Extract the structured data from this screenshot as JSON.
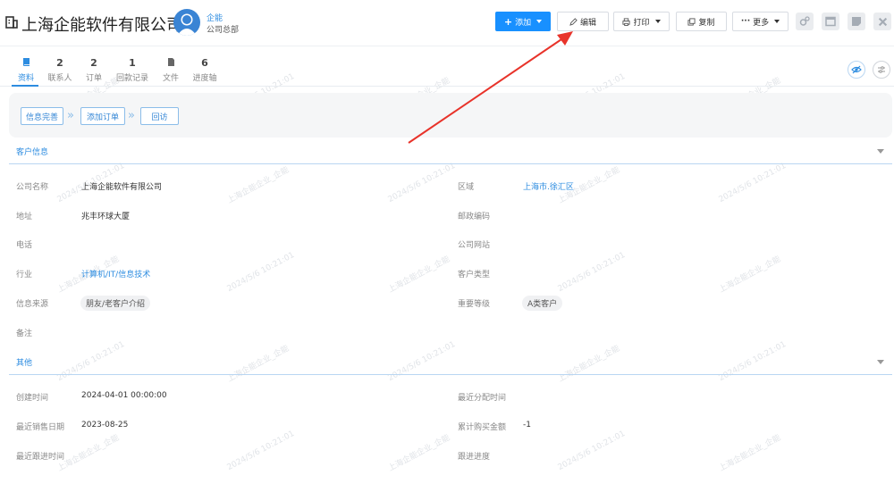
{
  "header": {
    "title": "上海企能软件有限公司",
    "owner_name": "企能",
    "owner_sub": "公司总部",
    "buttons": {
      "add": "添加",
      "edit": "编辑",
      "print": "打印",
      "copy": "复制",
      "more": "更多"
    }
  },
  "tabs": [
    {
      "count": "",
      "label": "资料"
    },
    {
      "count": "2",
      "label": "联系人"
    },
    {
      "count": "2",
      "label": "订单"
    },
    {
      "count": "1",
      "label": "回款记录"
    },
    {
      "count": "",
      "label": "文件"
    },
    {
      "count": "6",
      "label": "进度轴"
    }
  ],
  "progress": [
    "信息完善",
    "添加订单",
    "回访"
  ],
  "sections": {
    "customer": "客户信息",
    "other": "其他"
  },
  "fields": {
    "company_name": {
      "label": "公司名称",
      "value": "上海企能软件有限公司"
    },
    "region": {
      "label": "区域",
      "value": "上海市.徐汇区"
    },
    "address": {
      "label": "地址",
      "value": "兆丰环球大厦"
    },
    "postcode": {
      "label": "邮政编码",
      "value": ""
    },
    "phone": {
      "label": "电话",
      "value": ""
    },
    "website": {
      "label": "公司网站",
      "value": ""
    },
    "industry": {
      "label": "行业",
      "value": "计算机/IT/信息技术"
    },
    "customer_type": {
      "label": "客户类型",
      "value": ""
    },
    "source": {
      "label": "信息来源",
      "value": "朋友/老客户介绍"
    },
    "level": {
      "label": "重要等级",
      "value": "A类客户"
    },
    "remark": {
      "label": "备注",
      "value": ""
    },
    "created": {
      "label": "创建时间",
      "value": "2024-04-01 00:00:00"
    },
    "last_assign": {
      "label": "最近分配时间",
      "value": ""
    },
    "last_sale": {
      "label": "最近销售日期",
      "value": "2023-08-25"
    },
    "total_purchase": {
      "label": "累计购买金额",
      "value": "-1"
    },
    "last_follow": {
      "label": "最近跟进时间",
      "value": ""
    },
    "follow_progress": {
      "label": "跟进进度",
      "value": ""
    }
  },
  "watermark": {
    "text": "上海企能企业_企能",
    "date": "2024/5/6 10:21:01"
  },
  "colors": {
    "primary": "#1890ff",
    "link": "#2d8ce0",
    "arrow": "#e8332a"
  }
}
